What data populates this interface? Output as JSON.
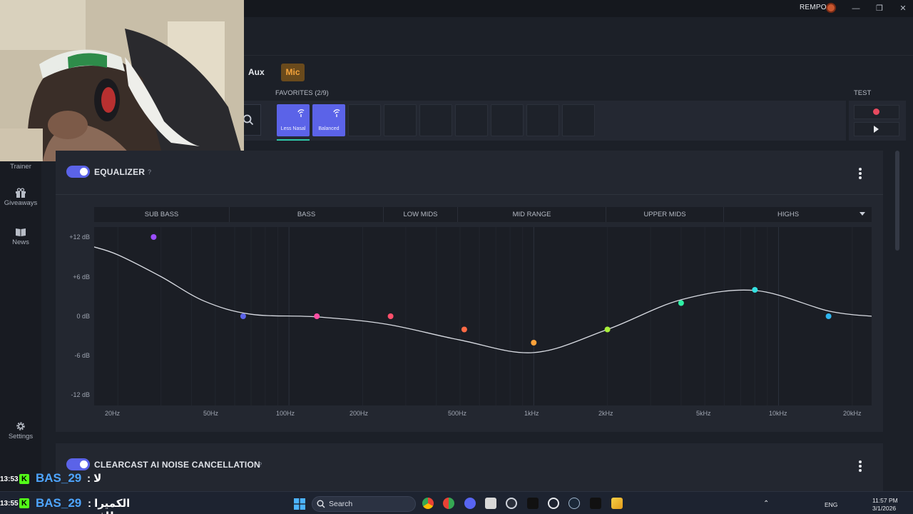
{
  "window": {
    "user_label": "REMPO",
    "controls": {
      "minimize": "—",
      "restore": "❐",
      "close": "✕"
    }
  },
  "sidebar": {
    "items": [
      {
        "label": "Trainer"
      },
      {
        "label": "Giveaways"
      },
      {
        "label": "News"
      },
      {
        "label": "Settings"
      }
    ]
  },
  "tabs": {
    "aux": "Aux",
    "mic": "Mic"
  },
  "favorites": {
    "label": "FAVORITES (2/9)",
    "presets": [
      {
        "name": "Less Nasal"
      },
      {
        "name": "Balanced"
      }
    ]
  },
  "test": {
    "label": "TEST"
  },
  "equalizer": {
    "title": "EQUALIZER",
    "help": "?",
    "enabled": true,
    "bands": [
      "SUB BASS",
      "BASS",
      "LOW MIDS",
      "MID RANGE",
      "UPPER MIDS",
      "HIGHS"
    ],
    "y_labels": [
      "+12 dB",
      "+6 dB",
      "0 dB",
      "-6 dB",
      "-12 dB"
    ],
    "x_labels": [
      "20Hz",
      "50Hz",
      "100Hz",
      "200Hz",
      "500Hz",
      "1kHz",
      "2kHz",
      "5kHz",
      "10kHz",
      "20kHz"
    ]
  },
  "chart_data": {
    "type": "line",
    "x_scale": "log",
    "xlim_hz": [
      16,
      24000
    ],
    "ylim_db": [
      -12,
      12
    ],
    "points": [
      {
        "hz": 28,
        "db": 12,
        "color": "#9b4dff"
      },
      {
        "hz": 65,
        "db": 0,
        "color": "#5b63e8"
      },
      {
        "hz": 130,
        "db": 0,
        "color": "#ff4fa3"
      },
      {
        "hz": 260,
        "db": 0,
        "color": "#ff4f6b"
      },
      {
        "hz": 520,
        "db": -2,
        "color": "#ff6a45"
      },
      {
        "hz": 1000,
        "db": -4,
        "color": "#ffa23a"
      },
      {
        "hz": 2000,
        "db": -2,
        "color": "#a8f03a"
      },
      {
        "hz": 4000,
        "db": 2,
        "color": "#2ff0a5"
      },
      {
        "hz": 8000,
        "db": 4,
        "color": "#34e0e0"
      },
      {
        "hz": 16000,
        "db": 0,
        "color": "#2eb6f0"
      }
    ],
    "curve": [
      {
        "hz": 16,
        "db": 10.5
      },
      {
        "hz": 20,
        "db": 9.3
      },
      {
        "hz": 30,
        "db": 6
      },
      {
        "hz": 45,
        "db": 2.3
      },
      {
        "hz": 70,
        "db": 0.3
      },
      {
        "hz": 130,
        "db": -0.1
      },
      {
        "hz": 250,
        "db": -1.2
      },
      {
        "hz": 500,
        "db": -3.6
      },
      {
        "hz": 1000,
        "db": -5.5
      },
      {
        "hz": 2000,
        "db": -2
      },
      {
        "hz": 4000,
        "db": 2.5
      },
      {
        "hz": 8000,
        "db": 3.9
      },
      {
        "hz": 16000,
        "db": 0.8
      },
      {
        "hz": 24000,
        "db": 0
      }
    ]
  },
  "clearcast": {
    "title": "CLEARCAST AI NOISE CANCELLATION",
    "help": "?"
  },
  "chat": [
    {
      "time": "13:53",
      "user": "BAS_29",
      "message": ": لا"
    },
    {
      "time": "13:55",
      "user": "BAS_29",
      "message": ": الكميرا طافيه"
    }
  ],
  "taskbar": {
    "search": "Search",
    "tray": {
      "lang": "ENG",
      "time": "11:57 PM",
      "date": "3/1/2026"
    }
  }
}
